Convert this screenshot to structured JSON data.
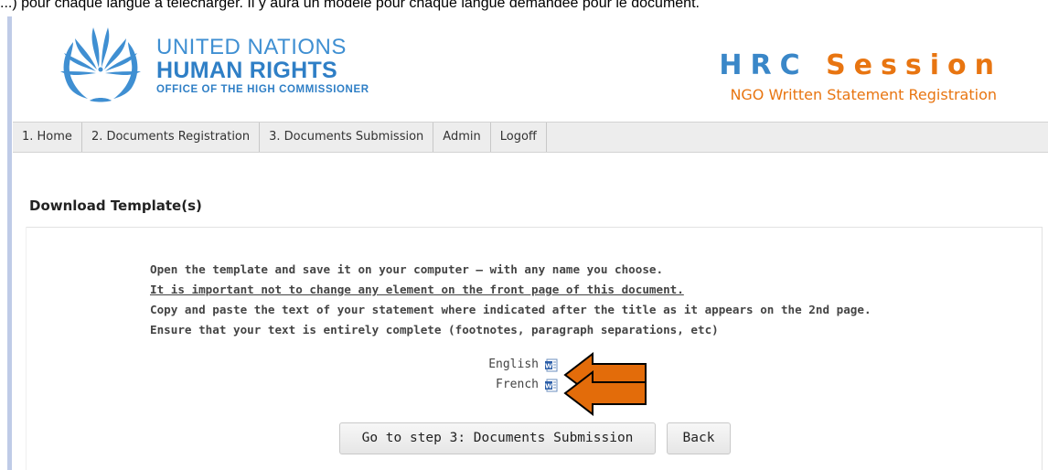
{
  "caption": "...) pour chaque langue à télécharger. Il y aura un modèle pour chaque langue demandée pour le document.",
  "logo": {
    "line1": "UNITED NATIONS",
    "line2": "HUMAN RIGHTS",
    "line3": "OFFICE OF THE HIGH COMMISSIONER"
  },
  "header": {
    "title_part1": "HRC ",
    "title_part2": "Session",
    "subtitle": "NGO Written Statement Registration"
  },
  "nav": [
    {
      "label": "1. Home"
    },
    {
      "label": "2. Documents Registration"
    },
    {
      "label": "3. Documents Submission"
    },
    {
      "label": "Admin"
    },
    {
      "label": "Logoff"
    }
  ],
  "section": {
    "title": "Download Template(s)"
  },
  "instructions": [
    "Open the template and save it on your computer – with any name you choose.",
    "It is important not to change any element on the front page of this document.",
    "Copy and paste the text of your statement where indicated after the title as it appears on the 2nd page.",
    "Ensure that your text is entirely complete (footnotes, paragraph separations, etc)"
  ],
  "downloads": [
    {
      "label": "English",
      "icon": "word-document-icon"
    },
    {
      "label": "French",
      "icon": "word-document-icon"
    }
  ],
  "buttons": {
    "step3": "Go to step 3: Documents Submission",
    "back": "Back"
  },
  "colors": {
    "brand_blue": "#3a87c8",
    "accent_orange": "#e87511",
    "arrow_fill": "#e36c0a"
  }
}
